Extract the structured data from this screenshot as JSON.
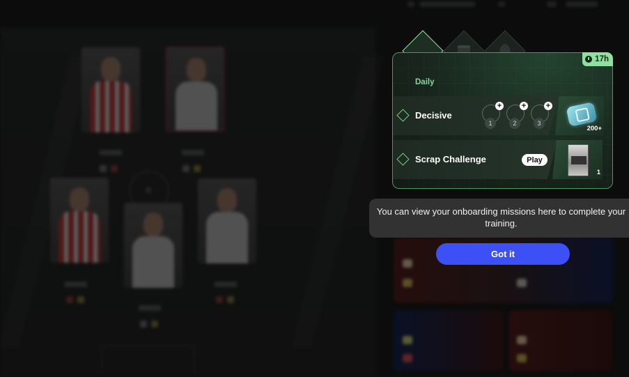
{
  "missions_panel": {
    "tabs": [
      {
        "name": "clock-icon",
        "active": true
      },
      {
        "name": "calendar-icon",
        "active": false
      },
      {
        "name": "flame-icon",
        "active": false
      }
    ],
    "timer": "17h",
    "section_label": "Daily",
    "missions": [
      {
        "title": "Decisive",
        "steps": [
          "1",
          "2",
          "3"
        ],
        "reward_count": "200+"
      },
      {
        "title": "Scrap Challenge",
        "action_label": "Play",
        "reward_count": "1"
      }
    ]
  },
  "tooltip": {
    "text": "You can view your onboarding missions here to complete your training."
  },
  "got_it_button": {
    "label": "Got it"
  },
  "colors": {
    "accent_green": "#8fe0a0",
    "button_blue": "#3d50f5"
  }
}
